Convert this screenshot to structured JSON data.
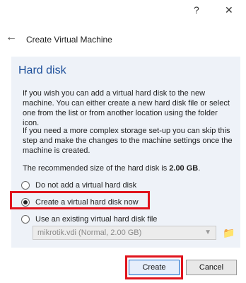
{
  "window": {
    "help": "?",
    "close": "✕"
  },
  "header": {
    "back": "←",
    "title": "Create Virtual Machine"
  },
  "section": {
    "title": "Hard disk"
  },
  "paragraphs": {
    "p1": "If you wish you can add a virtual hard disk to the new machine. You can either create a new hard disk file or select one from the list or from another location using the folder icon.",
    "p2": "If you need a more complex storage set-up you can skip this step and make the changes to the machine settings once the machine is created.",
    "p3_prefix": "The recommended size of the hard disk is ",
    "p3_size": "2.00 GB",
    "p3_suffix": "."
  },
  "options": {
    "none": "Do not add a virtual hard disk",
    "create": "Create a virtual hard disk now",
    "existing": "Use an existing virtual hard disk file",
    "selected": "create"
  },
  "existing_select": {
    "value": "mikrotik.vdi (Normal, 2.00 GB)"
  },
  "buttons": {
    "create": "Create",
    "cancel": "Cancel"
  }
}
